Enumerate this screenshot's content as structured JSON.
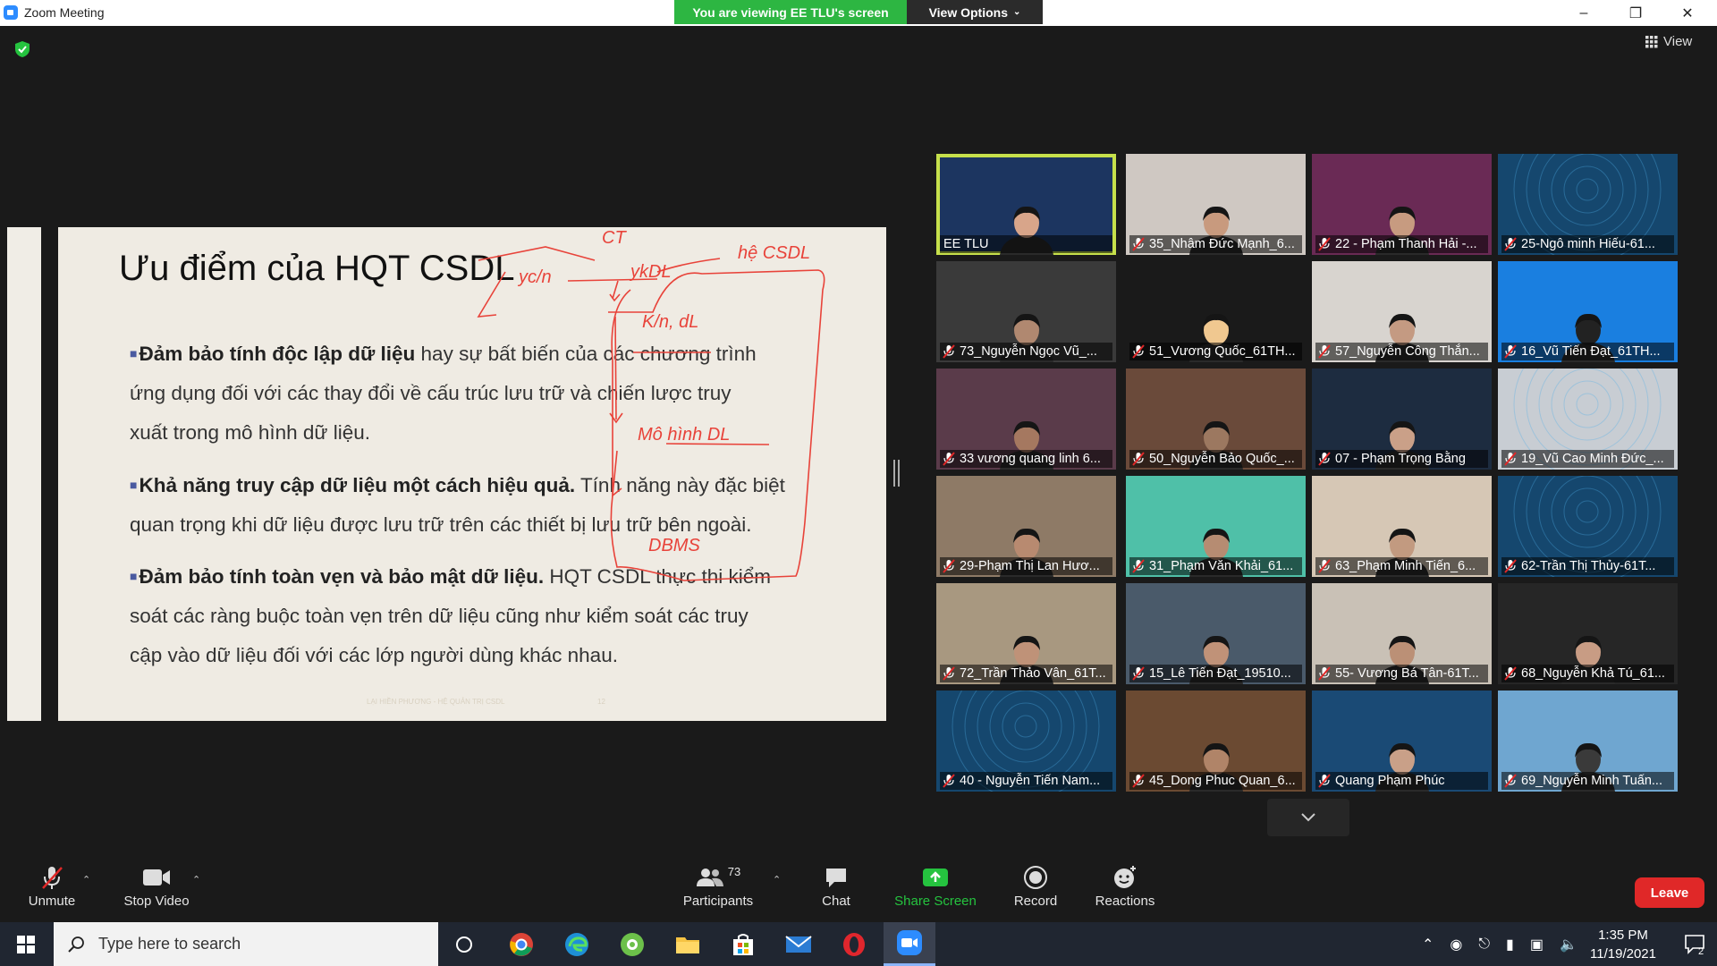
{
  "window": {
    "title": "Zoom Meeting"
  },
  "banner": {
    "viewing_text": "You are viewing EE TLU's screen",
    "view_options_label": "View Options"
  },
  "view_label": "View",
  "slide": {
    "title": "Ưu điểm của HQT CSDL",
    "bullets": [
      {
        "bold": "Đảm bảo tính độc lập dữ liệu",
        "lines": [
          " hay sự bất biến của các chương  trình",
          "ứng dụng đối với các thay đổi về cấu trúc lưu trữ và chiến  lược truy",
          "xuất trong mô hình dữ liệu."
        ]
      },
      {
        "bold": "Khả năng truy cập dữ liệu một cách hiệu quả.",
        "lines": [
          " Tính năng này đặc  biệt",
          "quan trọng khi dữ liệu được lưu trữ trên các thiết bị lưu trữ  bên ngoài."
        ]
      },
      {
        "bold": "Đảm bảo tính toàn vẹn và bảo mật dữ liệu.",
        "lines": [
          " HQT CSDL thực thi  kiểm",
          "soát các ràng buộc toàn vẹn trên dữ liệu cũng như kiểm  soát các truy",
          "cập vào dữ liệu đối với các lớp người dùng khác  nhau."
        ]
      }
    ],
    "footer": "LẠI HIỀN PHƯƠNG - HỆ QUẢN TRỊ CSDL",
    "page_number": "12",
    "annotations": [
      "CT",
      "yc/n",
      "ykDL",
      "hệ CSDL",
      "K/n, dL",
      "Mô hình DL",
      "DBMS"
    ]
  },
  "participants": [
    {
      "name": "EE TLU",
      "active": true,
      "muted": false,
      "bg": "#1c3560",
      "skin": "#d8a58a"
    },
    {
      "name": "35_Nhâm Đức Mạnh_6...",
      "muted": true,
      "bg": "#cfc8c2",
      "skin": "#c89a7e"
    },
    {
      "name": "22 - Phạm Thanh Hải -...",
      "muted": true,
      "bg": "#6a2a55",
      "skin": "#c79b80"
    },
    {
      "name": "25-Ngô minh Hiếu-61...",
      "muted": true,
      "bg": "#15476e",
      "skin": ""
    },
    {
      "name": "73_Nguyễn Ngọc Vũ_...",
      "muted": true,
      "bg": "#3a3a3a",
      "skin": "#b08870"
    },
    {
      "name": "51_Vương Quốc_61TH...",
      "muted": true,
      "bg": "#1a1a1a",
      "skin": "#f0c890"
    },
    {
      "name": "57_Nguyễn Công Thắn...",
      "muted": true,
      "bg": "#d8d4cf",
      "skin": "#c49a82"
    },
    {
      "name": "16_Vũ Tiến Đạt_61TH...",
      "muted": true,
      "bg": "#1a7fe0",
      "skin": "#222222"
    },
    {
      "name": "33 vương quang linh 6...",
      "muted": true,
      "bg": "#5a3b4a",
      "skin": "#a57860"
    },
    {
      "name": "50_Nguyễn Bảo Quốc_...",
      "muted": true,
      "bg": "#6a4a3a",
      "skin": "#9c7860"
    },
    {
      "name": "07 - Phạm Trọng Bằng",
      "muted": true,
      "bg": "#1d2c40",
      "skin": "#caa088"
    },
    {
      "name": "19_Vũ Cao Minh Đức_...",
      "muted": true,
      "bg": "#c8cdd3",
      "skin": ""
    },
    {
      "name": "29-Phạm Thị Lan Hươ...",
      "muted": true,
      "bg": "#8e7a66",
      "skin": "#b88a70"
    },
    {
      "name": "31_Phạm Văn Khải_61...",
      "muted": true,
      "bg": "#4fc0a8",
      "skin": "#b68c72"
    },
    {
      "name": "63_Phạm Minh Tiến_6...",
      "muted": true,
      "bg": "#d6c7b5",
      "skin": "#c29a80"
    },
    {
      "name": "62-Trần Thị Thủy-61T...",
      "muted": true,
      "bg": "#15476e",
      "skin": ""
    },
    {
      "name": "72_Trần Thảo Vân_61T...",
      "muted": true,
      "bg": "#a89880",
      "skin": "#bf9278"
    },
    {
      "name": "15_Lê Tiến Đạt_19510...",
      "muted": true,
      "bg": "#4a5a6a",
      "skin": "#c09278"
    },
    {
      "name": "55- Vương Bá Tân-61T...",
      "muted": true,
      "bg": "#c9c1b6",
      "skin": "#bb9076"
    },
    {
      "name": "68_Nguyễn Khả Tú_61...",
      "muted": true,
      "bg": "#262626",
      "skin": "#c89c84"
    },
    {
      "name": "40 - Nguyễn Tiến Nam...",
      "muted": true,
      "bg": "#15476e",
      "skin": ""
    },
    {
      "name": "45_Dong Phuc Quan_6...",
      "muted": true,
      "bg": "#6b4a32",
      "skin": "#b08468"
    },
    {
      "name": "Quang Phạm Phúc",
      "muted": true,
      "bg": "#1a4a75",
      "skin": "#c9a088"
    },
    {
      "name": "69_Nguyễn Minh Tuấn...",
      "muted": true,
      "bg": "#6fa6d0",
      "skin": "#3a3a3a"
    }
  ],
  "toolbar": {
    "unmute": "Unmute",
    "stop_video": "Stop Video",
    "participants": "Participants",
    "participant_count": "73",
    "chat": "Chat",
    "share_screen": "Share Screen",
    "record": "Record",
    "reactions": "Reactions",
    "leave": "Leave"
  },
  "taskbar": {
    "search_placeholder": "Type here to search",
    "time": "1:35 PM",
    "date": "11/19/2021",
    "notification_count": "2"
  },
  "colors": {
    "accent_green": "#2db642",
    "share_green": "#25c33f",
    "leave_red": "#e02828",
    "active_speaker": "#c6e04b",
    "ink_red": "#e8433a"
  }
}
